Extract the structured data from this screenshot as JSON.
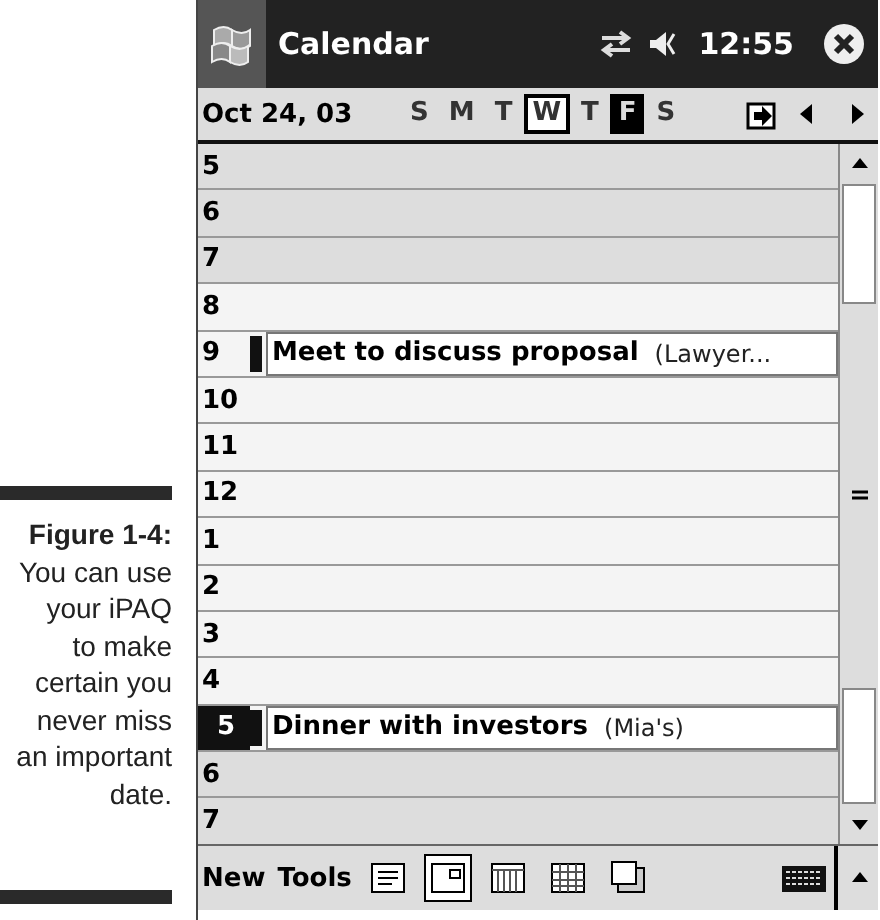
{
  "caption": {
    "title": "Figure 1-4:",
    "lines": [
      "You can use",
      "your iPAQ",
      "to make",
      "certain you",
      "never miss",
      "an important",
      "date."
    ]
  },
  "window": {
    "title": "Calendar",
    "time": "12:55"
  },
  "toolbar": {
    "date": "Oct 24, 03",
    "weekdays": [
      {
        "label": "S",
        "today": false,
        "selected": false
      },
      {
        "label": "M",
        "today": false,
        "selected": false
      },
      {
        "label": "T",
        "today": false,
        "selected": false
      },
      {
        "label": "W",
        "today": true,
        "selected": false
      },
      {
        "label": "T",
        "today": false,
        "selected": false
      },
      {
        "label": "F",
        "today": false,
        "selected": true
      },
      {
        "label": "S",
        "today": false,
        "selected": false
      }
    ]
  },
  "hours": [
    {
      "label": "5",
      "shaded": true,
      "selected": false
    },
    {
      "label": "6",
      "shaded": true,
      "selected": false
    },
    {
      "label": "7",
      "shaded": true,
      "selected": false
    },
    {
      "label": "8",
      "shaded": false,
      "selected": false
    },
    {
      "label": "9",
      "shaded": false,
      "selected": false,
      "appointment": {
        "title": "Meet to discuss proposal",
        "location": "(Lawyer..."
      }
    },
    {
      "label": "10",
      "shaded": false,
      "selected": false
    },
    {
      "label": "11",
      "shaded": false,
      "selected": false
    },
    {
      "label": "12",
      "shaded": false,
      "selected": false
    },
    {
      "label": "1",
      "shaded": false,
      "selected": false
    },
    {
      "label": "2",
      "shaded": false,
      "selected": false
    },
    {
      "label": "3",
      "shaded": false,
      "selected": false
    },
    {
      "label": "4",
      "shaded": false,
      "selected": false
    },
    {
      "label": "5",
      "shaded": false,
      "selected": true,
      "appointment": {
        "title": "Dinner with investors",
        "location": "(Mia's)"
      }
    },
    {
      "label": "6",
      "shaded": true,
      "selected": false
    },
    {
      "label": "7",
      "shaded": true,
      "selected": false
    }
  ],
  "menu": [
    "New",
    "Tools"
  ],
  "views": [
    {
      "kind": "agenda",
      "selected": false
    },
    {
      "kind": "day",
      "selected": true
    },
    {
      "kind": "week",
      "selected": false
    },
    {
      "kind": "month",
      "selected": false
    },
    {
      "kind": "year",
      "selected": false
    }
  ]
}
